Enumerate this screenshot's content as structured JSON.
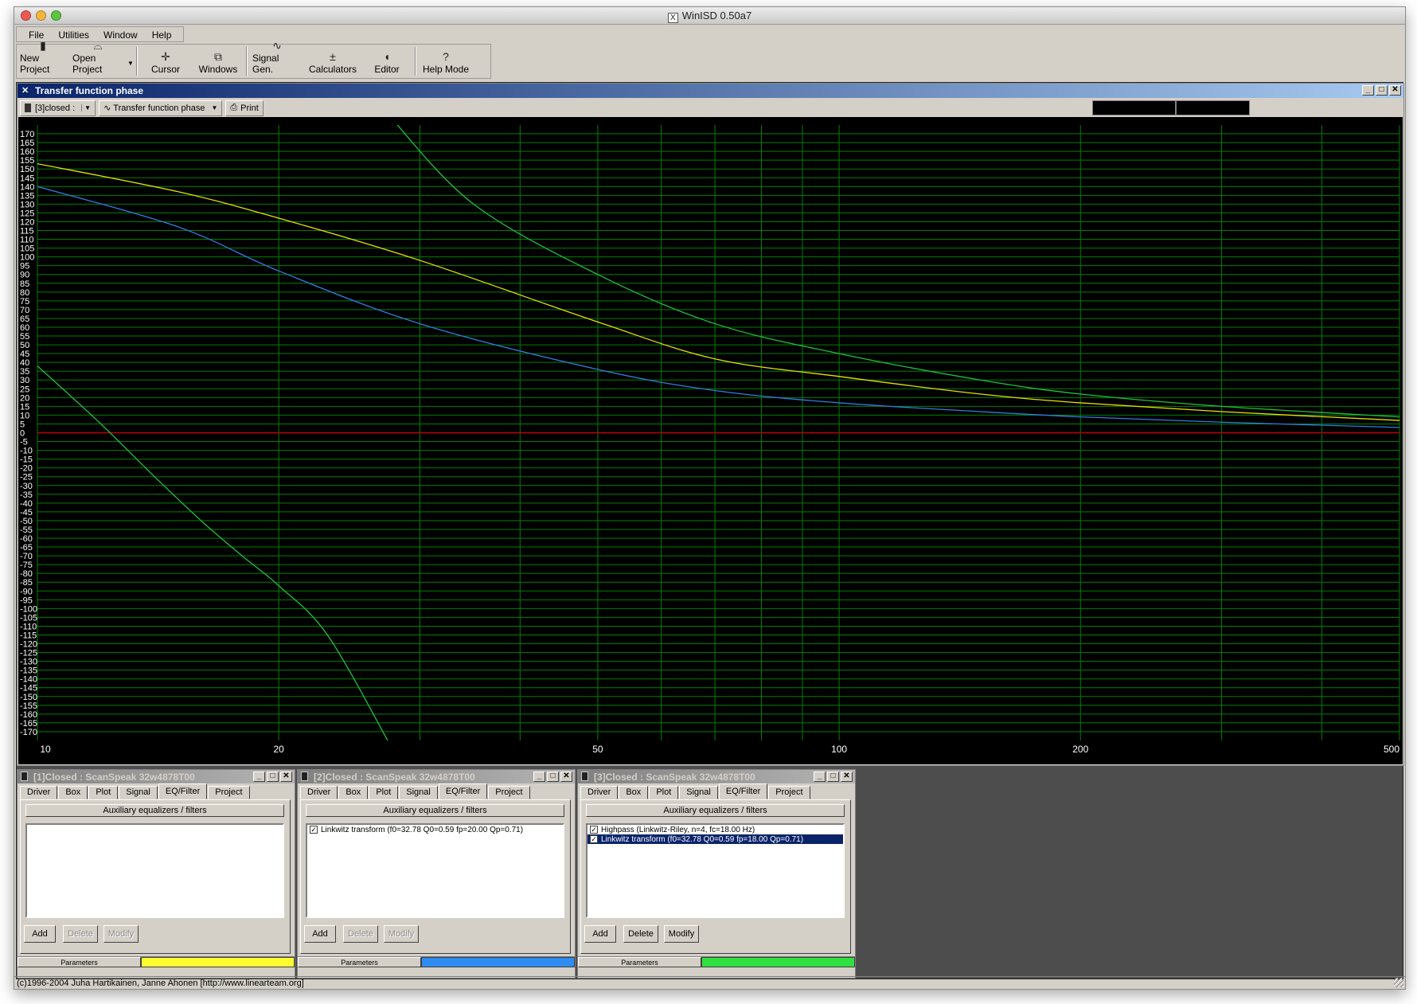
{
  "app": {
    "title": "WinISD 0.50a7",
    "menu": [
      "File",
      "Utilities",
      "Window",
      "Help"
    ],
    "toolbar": [
      {
        "label": "New Project",
        "icon": "new-project-icon"
      },
      {
        "label": "Open Project",
        "icon": "open-folder-icon"
      },
      {
        "label": "Cursor",
        "icon": "cursor-icon"
      },
      {
        "label": "Windows",
        "icon": "windows-icon"
      },
      {
        "label": "Signal Gen.",
        "icon": "sine-wave-icon"
      },
      {
        "label": "Calculators",
        "icon": "calculator-icon"
      },
      {
        "label": "Editor",
        "icon": "editor-icon"
      },
      {
        "label": "Help Mode",
        "icon": "question-icon"
      }
    ],
    "status": "(c)1996-2004 Juha Hartikainen, Janne Ahonen [http://www.linearteam.org]"
  },
  "chart_window": {
    "title": "Transfer function phase",
    "project_select": "[3]closed :",
    "graph_select": "Transfer function phase",
    "print_label": "Print",
    "window_buttons": [
      "_",
      "□",
      "✕"
    ]
  },
  "chart_data": {
    "type": "line",
    "x_scale": "log",
    "xlim": [
      10,
      500
    ],
    "ylim": [
      -175,
      175
    ],
    "x_ticks": [
      "10",
      "20",
      "50",
      "100",
      "200",
      "500"
    ],
    "x_tick_values": [
      10,
      20,
      50,
      100,
      200,
      500
    ],
    "y_ticks": [
      170,
      165,
      160,
      155,
      150,
      145,
      140,
      135,
      130,
      125,
      120,
      115,
      110,
      105,
      100,
      95,
      90,
      85,
      80,
      75,
      70,
      65,
      60,
      55,
      50,
      45,
      40,
      35,
      30,
      25,
      20,
      15,
      10,
      5,
      0,
      -5,
      -10,
      -15,
      -20,
      -25,
      -30,
      -35,
      -40,
      -45,
      -50,
      -55,
      -60,
      -65,
      -70,
      -75,
      -80,
      -85,
      -90,
      -95,
      -100,
      -105,
      -110,
      -115,
      -120,
      -125,
      -130,
      -135,
      -140,
      -145,
      -150,
      -155,
      -160,
      -165,
      -170
    ],
    "grid": true,
    "colors": {
      "background": "#000000",
      "grid": "#008000",
      "zero_line": "#c00000",
      "axis_text": "#ffffff"
    },
    "series": [
      {
        "color": "#e8e000",
        "x": [
          10,
          15,
          20,
          30,
          50,
          70,
          100,
          150,
          200,
          300,
          500
        ],
        "y": [
          153,
          137,
          122,
          98,
          63,
          42,
          32,
          22,
          17,
          12,
          7
        ]
      },
      {
        "color": "#2f7de0",
        "x": [
          10,
          15,
          20,
          30,
          50,
          70,
          100,
          150,
          200,
          300,
          500
        ],
        "y": [
          140,
          117,
          92,
          62,
          36,
          24,
          17,
          12,
          9,
          6,
          3
        ]
      },
      {
        "color": "#20c040",
        "x": [
          27.5,
          35,
          50,
          70,
          100,
          150,
          200,
          300,
          500
        ],
        "y": [
          180,
          130,
          90,
          62,
          45,
          30,
          22,
          15,
          9
        ]
      },
      {
        "color": "#20c040",
        "x": [
          10,
          12,
          14,
          16,
          18,
          20,
          23,
          27.5
        ],
        "y": [
          38,
          5,
          -25,
          -50,
          -70,
          -87,
          -115,
          -177
        ]
      }
    ]
  },
  "project_windows": [
    {
      "title": "[1]Closed : ScanSpeak 32w4878T00",
      "tabs": [
        "Driver",
        "Box",
        "Plot",
        "Signal",
        "EQ/Filter",
        "Project"
      ],
      "active_tab": "EQ/Filter",
      "section": "Auxiliary equalizers / filters",
      "items": [],
      "buttons": [
        {
          "label": "Add",
          "enabled": true
        },
        {
          "label": "Delete",
          "enabled": false
        },
        {
          "label": "Modify",
          "enabled": false
        }
      ],
      "parameters_label": "Parameters",
      "series_color": "#ffff30"
    },
    {
      "title": "[2]Closed : ScanSpeak 32w4878T00",
      "tabs": [
        "Driver",
        "Box",
        "Plot",
        "Signal",
        "EQ/Filter",
        "Project"
      ],
      "active_tab": "EQ/Filter",
      "section": "Auxiliary equalizers / filters",
      "items": [
        {
          "label": "Linkwitz transform (f0=32.78 Q0=0.59 fp=20.00 Qp=0.71)",
          "checked": true,
          "selected": false
        }
      ],
      "buttons": [
        {
          "label": "Add",
          "enabled": true
        },
        {
          "label": "Delete",
          "enabled": false
        },
        {
          "label": "Modify",
          "enabled": false
        }
      ],
      "parameters_label": "Parameters",
      "series_color": "#2f8cf0"
    },
    {
      "title": "[3]Closed : ScanSpeak 32w4878T00",
      "tabs": [
        "Driver",
        "Box",
        "Plot",
        "Signal",
        "EQ/Filter",
        "Project"
      ],
      "active_tab": "EQ/Filter",
      "section": "Auxiliary equalizers / filters",
      "items": [
        {
          "label": "Highpass (Linkwitz-Riley, n=4, fc=18.00 Hz)",
          "checked": true,
          "selected": false
        },
        {
          "label": "Linkwitz transform (f0=32.78 Q0=0.59 fp=18.00 Qp=0.71)",
          "checked": true,
          "selected": true
        }
      ],
      "buttons": [
        {
          "label": "Add",
          "enabled": true
        },
        {
          "label": "Delete",
          "enabled": true
        },
        {
          "label": "Modify",
          "enabled": true
        }
      ],
      "parameters_label": "Parameters",
      "series_color": "#30e040"
    }
  ]
}
